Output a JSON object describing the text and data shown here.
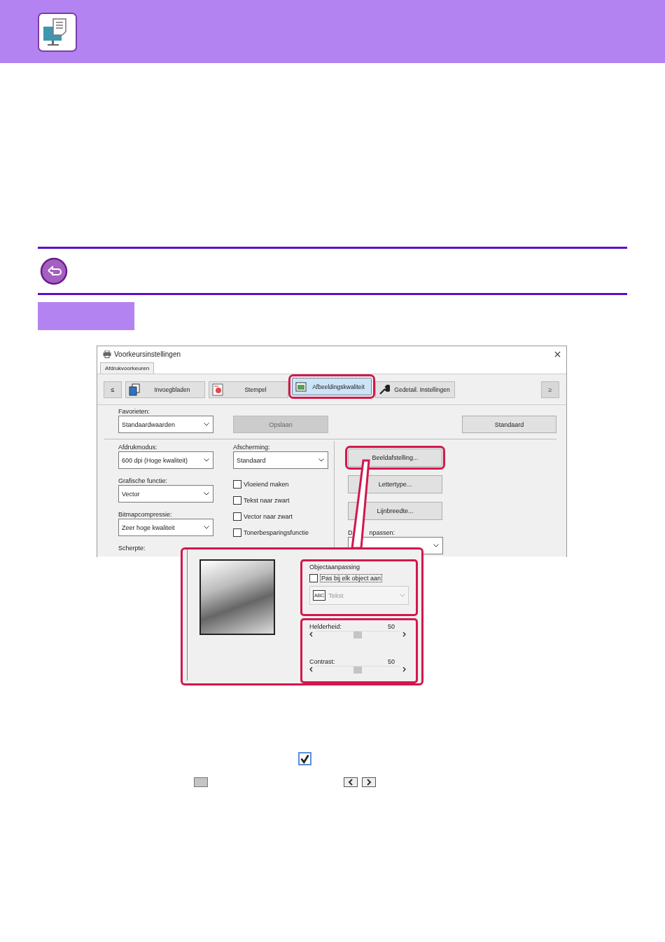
{
  "dialog": {
    "title": "Voorkeursinstellingen",
    "tab": "Afdrukvoorkeuren",
    "nav_prev": {
      "label": "≤",
      "disabled": false
    },
    "nav_next": {
      "label": "≥",
      "disabled": true
    },
    "tabs": [
      {
        "label": "Invoegbladen",
        "kind": "pages",
        "selected": false,
        "highlighted": false
      },
      {
        "label": "Stempel",
        "kind": "stamp",
        "selected": false,
        "highlighted": false
      },
      {
        "label": "Afbeeldingskwaliteit",
        "kind": "image",
        "selected": true,
        "highlighted": true
      },
      {
        "label": "Gedetail. Instellingen",
        "kind": "wrench",
        "selected": false,
        "highlighted": false
      }
    ],
    "favorites": {
      "label": "Favorieten:",
      "value": "Standaardwaarden"
    },
    "save_button": {
      "label": "Opslaan",
      "disabled": true
    },
    "default_button": {
      "label": "Standaard",
      "disabled": false
    },
    "left_fields": [
      {
        "label": "Afdrukmodus:",
        "value": "600 dpi (Hoge kwaliteit)"
      },
      {
        "label": "Grafische functie:",
        "value": "Vector"
      },
      {
        "label": "Bitmapcompressie:",
        "value": "Zeer hoge kwaliteit"
      },
      {
        "label": "Scherpte:"
      }
    ],
    "screening": {
      "label": "Afscherming:",
      "value": "Standaard"
    },
    "checkboxes": [
      {
        "label": "Vloeiend maken",
        "checked": false
      },
      {
        "label": "Tekst naar zwart",
        "checked": false
      },
      {
        "label": "Vector naar zwart",
        "checked": false
      },
      {
        "label": "Tonerbesparingsfunctie",
        "checked": false
      }
    ],
    "side_buttons": [
      {
        "label": "Beeldafstelling...",
        "highlighted": true
      },
      {
        "label": "Lettertype...",
        "highlighted": false
      },
      {
        "label": "Lijnbreedte...",
        "highlighted": false
      }
    ],
    "document_fit": {
      "label_start": "D",
      "label_end": "npassen:"
    }
  },
  "inset": {
    "group_title": "Objectaanpassing",
    "per_object": {
      "label": "Pas bij elk object aan",
      "checked": false
    },
    "object_type": {
      "icon_text": "ABC",
      "value": "Tekst",
      "disabled": true
    },
    "sliders": [
      {
        "label": "Helderheid:",
        "reading": "50",
        "level": 0.5
      },
      {
        "label": "Contrast:",
        "reading": "50",
        "level": 0.5
      }
    ]
  },
  "legend": {
    "checked": true
  }
}
